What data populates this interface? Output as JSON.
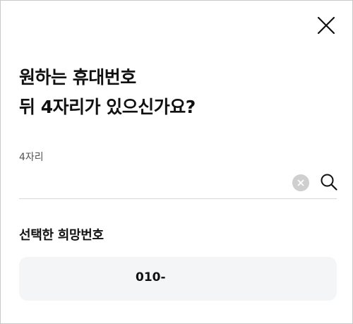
{
  "dialog": {
    "title_line1": "원하는 휴대번호",
    "title_line2": "뒤 4자리가 있으신가요?",
    "close_icon": "close-icon"
  },
  "search": {
    "label": "4자리",
    "value": "",
    "placeholder": "",
    "clear_icon": "clear-circle-icon",
    "search_icon": "search-icon"
  },
  "selected": {
    "title": "선택한 희망번호",
    "number": "010-"
  },
  "colors": {
    "text": "#111111",
    "label": "#555555",
    "divider": "#d6d6d6",
    "clear_button": "#cfcfcf",
    "number_box": "#f4f5f7"
  }
}
